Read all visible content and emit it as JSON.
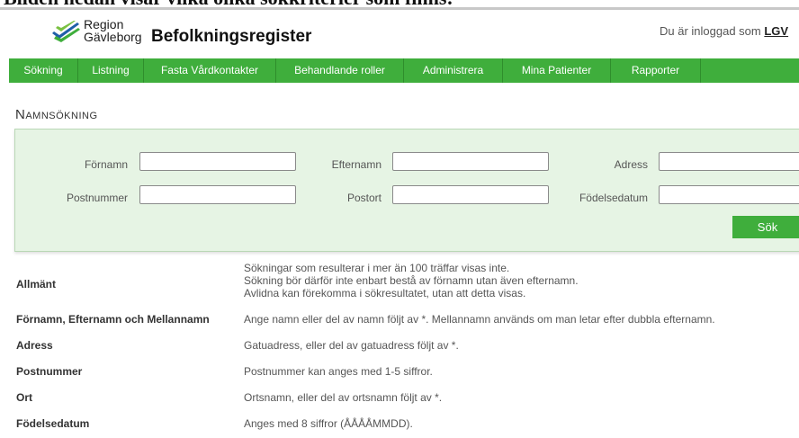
{
  "caption": "Bilden nedan visar vilka olika sökkriterier som finns:",
  "header": {
    "logo_text_line1": "Region",
    "logo_text_line2": "Gävleborg",
    "title": "Befolkningsregister",
    "login_prefix": "Du är inloggad som",
    "login_user": "LGV"
  },
  "nav": {
    "items": [
      {
        "label": "Sökning"
      },
      {
        "label": "Listning"
      },
      {
        "label": "Fasta Vårdkontakter"
      },
      {
        "label": "Behandlande roller"
      },
      {
        "label": "Administrera"
      },
      {
        "label": "Mina Patienter"
      },
      {
        "label": "Rapporter"
      }
    ]
  },
  "page": {
    "section_title": "Namnsökning"
  },
  "search": {
    "fornamn_label": "Förnamn",
    "efternamn_label": "Efternamn",
    "adress_label": "Adress",
    "postnummer_label": "Postnummer",
    "postort_label": "Postort",
    "fodelsedatum_label": "Födelsedatum",
    "fornamn_value": "",
    "efternamn_value": "",
    "adress_value": "",
    "postnummer_value": "",
    "postort_value": "",
    "fodelsedatum_value": "",
    "button_label": "Sök"
  },
  "help": {
    "rows": [
      {
        "key": "Allmänt",
        "lines": [
          "Sökningar som resulterar i mer än 100 träffar visas inte.",
          "Sökning bör därför inte enbart bestå av förnamn utan även efternamn.",
          "Avlidna kan förekomma i sökresultatet, utan att detta visas."
        ]
      },
      {
        "key": "Förnamn, Efternamn och Mellannamn",
        "lines": [
          "Ange namn eller del av namn följt av *. Mellannamn används om man letar efter dubbla efternamn."
        ]
      },
      {
        "key": "Adress",
        "lines": [
          "Gatuadress, eller del av gatuadress följt av *."
        ]
      },
      {
        "key": "Postnummer",
        "lines": [
          "Postnummer kan anges med 1-5 siffror."
        ]
      },
      {
        "key": "Ort",
        "lines": [
          "Ortsnamn, eller del av ortsnamn följt av *."
        ]
      },
      {
        "key": "Födelsedatum",
        "lines": [
          "Anges med 8 siffror (ÅÅÅÅMMDD)."
        ]
      }
    ]
  },
  "colors": {
    "brand_green": "#3fae3c",
    "panel_bg": "#e6f4e4",
    "logo_blue": "#1f5fa8"
  }
}
